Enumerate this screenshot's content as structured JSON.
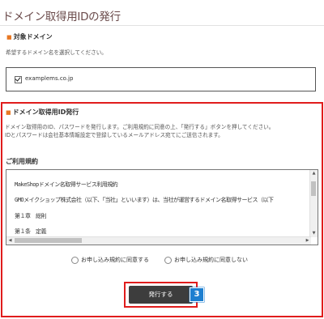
{
  "page": {
    "title": "ドメイン取得用IDの発行"
  },
  "target_domain": {
    "heading": "対象ドメイン",
    "instruction": "希望するドメイン名を選択してください。",
    "domain": "examplems.co.jp"
  },
  "id_issue": {
    "heading": "ドメイン取得用ID発行",
    "desc_line1": "ドメイン取得用のID、パスワードを発行します。ご利用規約に同意の上、「発行する」ボタンを押してください。",
    "desc_line2": "IDとパスワードは会社基本情報設定で登録しているメールアドレス宛てにご送信されます。",
    "terms_heading": "ご利用規約",
    "terms_lines": [
      "MakeShopドメイン名取得サービス利用規約",
      "GMOメイクショップ株式会社（以下、「当社」といいます）は、当社が運営するドメイン名取得サービス（以下",
      "第１章　総則",
      "第１条　定義"
    ],
    "agree_label": "お申し込み規約に同意する",
    "disagree_label": "お申し込み規約に同意しない",
    "submit_label": "発行する",
    "step_badge": "3"
  },
  "colors": {
    "frame": "#e01c1c",
    "badge": "#1d7fd0",
    "bullet": "#e87722",
    "button": "#3d3d3d"
  }
}
